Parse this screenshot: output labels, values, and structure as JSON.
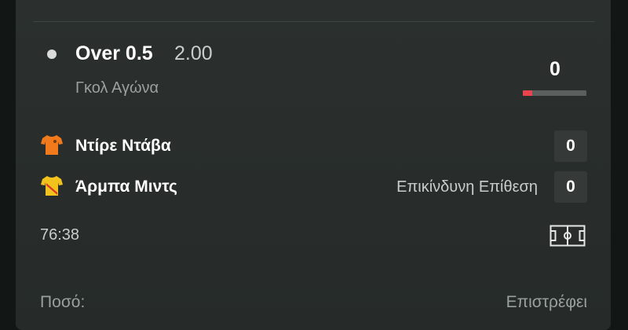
{
  "selection": {
    "name": "Over 0.5",
    "odds": "2.00",
    "market": "Γκολ Αγώνα",
    "stat_value": "0",
    "stat_bar_fill_fraction": 0.15,
    "stat_bar_color": "#e8434f"
  },
  "teams": [
    {
      "name": "Ντίρε Ντάβα",
      "score": "0",
      "event": "",
      "shirt": "orange-shirt-icon",
      "color": "#f07a1c"
    },
    {
      "name": "Άρμπα Μιντς",
      "score": "0",
      "event": "Επικίνδυνη Επίθεση",
      "shirt": "yellow-red-shirt-icon",
      "color": "#f4c21d"
    }
  ],
  "clock": "76:38",
  "footer": {
    "stake_label": "Ποσό:",
    "returns_label": "Επιστρέφει"
  }
}
